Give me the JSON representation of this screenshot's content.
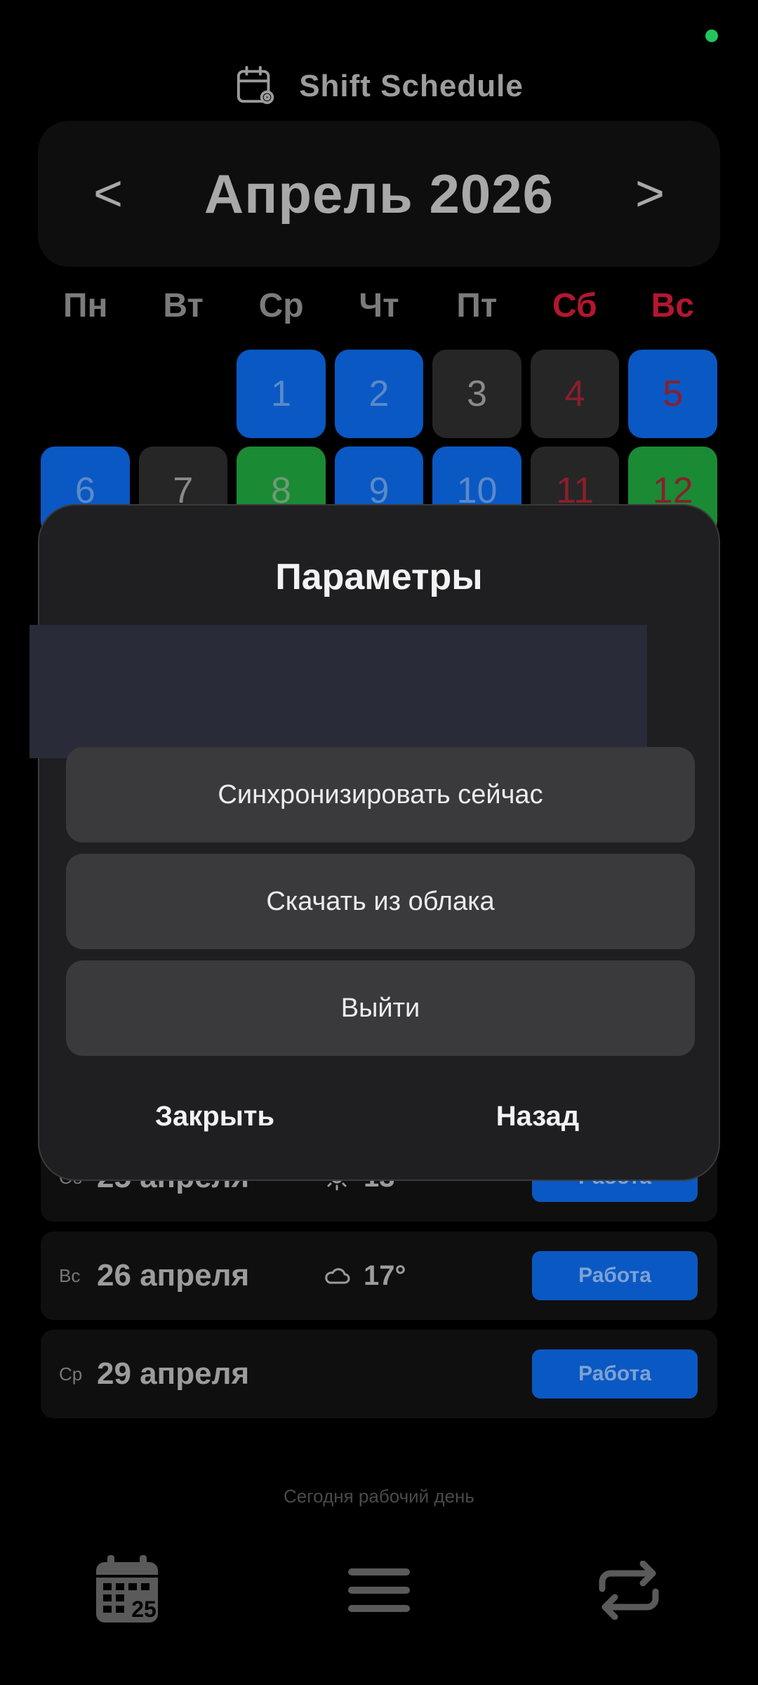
{
  "app": {
    "title": "Shift Schedule"
  },
  "calendar": {
    "month_label": "Апрель 2026",
    "prev_label": "<",
    "next_label": ">",
    "weekdays": [
      "Пн",
      "Вт",
      "Ср",
      "Чт",
      "Пт",
      "Сб",
      "Вс"
    ],
    "week1": [
      "",
      "",
      "1",
      "2",
      "3",
      "4",
      "5"
    ],
    "week2": [
      "6",
      "7",
      "8",
      "9",
      "10",
      "11",
      "12"
    ]
  },
  "shifts": [
    {
      "dow": "Сб",
      "date": "25 апреля",
      "weather_icon": "sun-icon",
      "temp": "13°",
      "status": "Работа"
    },
    {
      "dow": "Вс",
      "date": "26 апреля",
      "weather_icon": "cloud-icon",
      "temp": "17°",
      "status": "Работа"
    },
    {
      "dow": "Ср",
      "date": "29 апреля",
      "weather_icon": "",
      "temp": "",
      "status": "Работа"
    }
  ],
  "footer_note": "Сегодня рабочий день",
  "dialog": {
    "title": "Параметры",
    "sync_now": "Синхронизировать сейчас",
    "download_cloud": "Скачать из облака",
    "logout": "Выйти",
    "close": "Закрыть",
    "back": "Назад"
  },
  "colors": {
    "work_blue": "#0a58c3",
    "off_green": "#1b8a34",
    "weekend_red": "#b3172f",
    "status_green": "#22c55e"
  },
  "bottom_nav": {
    "calendar_icon_day": "25"
  }
}
